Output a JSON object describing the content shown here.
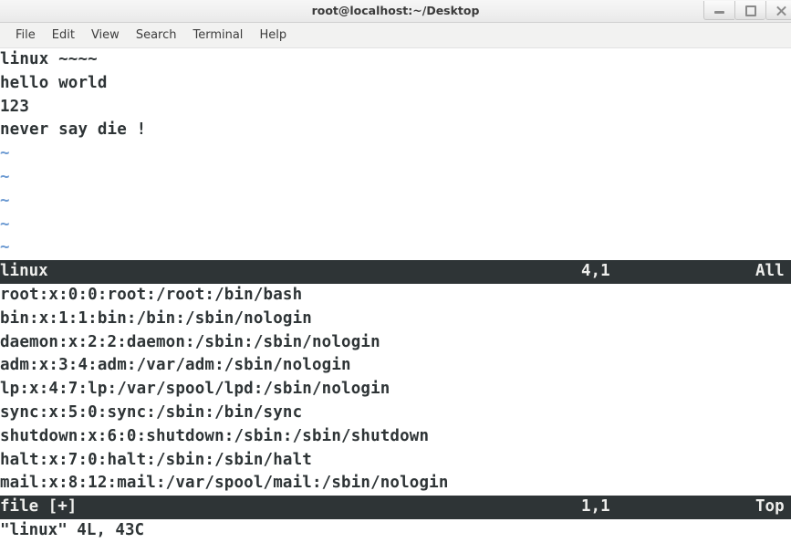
{
  "window": {
    "title": "root@localhost:~/Desktop",
    "buttons": [
      {
        "name": "minimize-button",
        "icon": "minimize-icon",
        "label": "_"
      },
      {
        "name": "maximize-button",
        "icon": "maximize-icon",
        "label": "□"
      },
      {
        "name": "close-button",
        "icon": "close-icon",
        "label": "×"
      }
    ]
  },
  "menubar": {
    "items": [
      {
        "label": "File"
      },
      {
        "label": "Edit"
      },
      {
        "label": "View"
      },
      {
        "label": "Search"
      },
      {
        "label": "Terminal"
      },
      {
        "label": "Help"
      }
    ]
  },
  "colors": {
    "terminal_bg": "#ffffff",
    "terminal_fg": "#2e3436",
    "statusbar_bg": "#2e3436",
    "statusbar_fg": "#eeeeec",
    "tilde_fg": "#6c9ad2",
    "titlebar_bg": "#f1f1f1",
    "menubar_bg": "#f2f2f1"
  },
  "terminal": {
    "top_window": {
      "lines": [
        "linux ~~~~",
        "hello world",
        "123",
        "never say die !"
      ],
      "empty_markers": [
        "~",
        "~",
        "~",
        "~",
        "~"
      ],
      "status": {
        "filename": "linux",
        "position": "4,1",
        "scroll": "All"
      }
    },
    "bottom_window": {
      "lines": [
        "root:x:0:0:root:/root:/bin/bash",
        "bin:x:1:1:bin:/bin:/sbin/nologin",
        "daemon:x:2:2:daemon:/sbin:/sbin/nologin",
        "adm:x:3:4:adm:/var/adm:/sbin/nologin",
        "lp:x:4:7:lp:/var/spool/lpd:/sbin/nologin",
        "sync:x:5:0:sync:/sbin:/bin/sync",
        "shutdown:x:6:0:shutdown:/sbin:/sbin/shutdown",
        "halt:x:7:0:halt:/sbin:/sbin/halt",
        "mail:x:8:12:mail:/var/spool/mail:/sbin/nologin"
      ],
      "status": {
        "filename": "file [+]",
        "position": "1,1",
        "scroll": "Top"
      }
    },
    "command_line": "\"linux\" 4L, 43C"
  }
}
